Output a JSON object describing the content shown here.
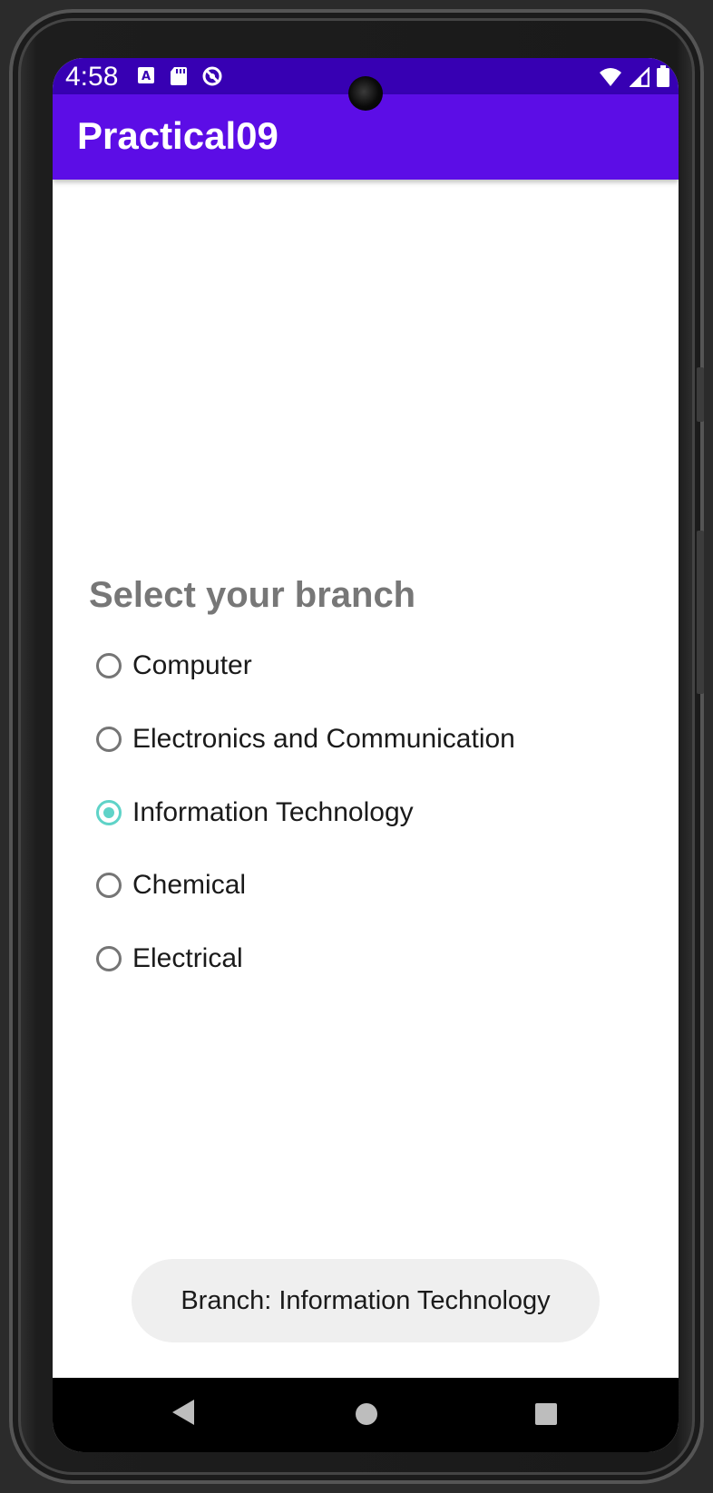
{
  "status_bar": {
    "time": "4:58",
    "left_icons": [
      "a-notification-icon",
      "sd-card-icon",
      "no-disturb-icon"
    ],
    "right_icons": [
      "wifi-icon",
      "cell-signal-icon",
      "battery-icon"
    ]
  },
  "app_bar": {
    "title": "Practical09"
  },
  "main": {
    "heading": "Select your branch",
    "options": [
      {
        "label": "Computer",
        "checked": false
      },
      {
        "label": "Electronics and Communication",
        "checked": false
      },
      {
        "label": "Information Technology",
        "checked": true
      },
      {
        "label": "Chemical",
        "checked": false
      },
      {
        "label": "Electrical",
        "checked": false
      }
    ]
  },
  "toast": {
    "text": "Branch: Information Technology"
  },
  "nav_bar": {
    "icons": [
      "back-icon",
      "home-icon",
      "recents-icon"
    ]
  },
  "colors": {
    "status_bar": "#3700b3",
    "app_bar": "#5c0de6",
    "radio_checked": "#5fd3c8",
    "heading": "#777777"
  }
}
